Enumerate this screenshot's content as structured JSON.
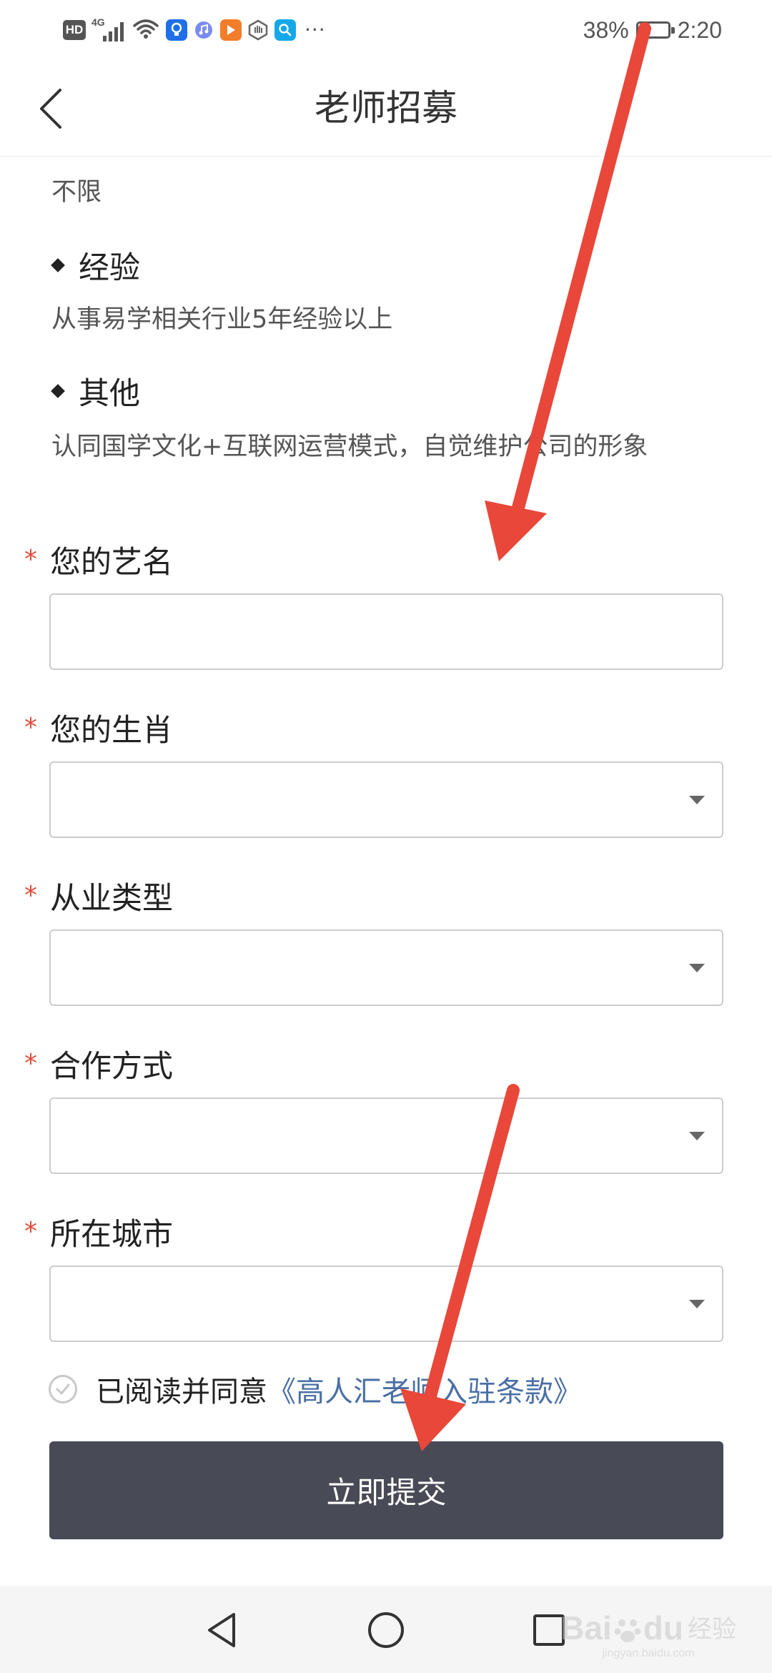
{
  "status_bar": {
    "hd_badge": "HD",
    "network": "4G",
    "overflow": "···",
    "battery_percent": "38%",
    "battery_level": 0.38,
    "time": "2:20"
  },
  "header": {
    "title": "老师招募"
  },
  "requirements": {
    "partial_text": "不限",
    "sections": [
      {
        "heading": "经验",
        "body": "从事易学相关行业5年经验以上"
      },
      {
        "heading": "其他",
        "body": "认同国学文化+互联网运营模式，自觉维护公司的形象"
      }
    ]
  },
  "form": {
    "required_mark": "*",
    "fields": [
      {
        "label": "您的艺名",
        "value": "",
        "type": "text"
      },
      {
        "label": "您的生肖",
        "value": "",
        "type": "select"
      },
      {
        "label": "从业类型",
        "value": "",
        "type": "select"
      },
      {
        "label": "合作方式",
        "value": "",
        "type": "select"
      },
      {
        "label": "所在城市",
        "value": "",
        "type": "select"
      }
    ],
    "agreement": {
      "text": "已阅读并同意",
      "link": "《高人汇老师入驻条款》"
    },
    "submit_label": "立即提交"
  },
  "watermark": {
    "brand": "Bai",
    "brand_suffix": "du",
    "label": "经验",
    "url": "jingyan.baidu.com"
  },
  "colors": {
    "required": "#e44b3e",
    "link": "#4a6fa5",
    "submit_bg": "#484a56",
    "annotation_arrow": "#e8473a"
  }
}
